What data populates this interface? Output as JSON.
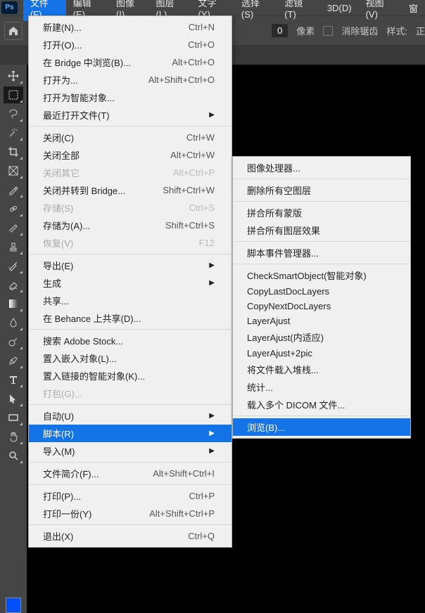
{
  "menubar": {
    "items": [
      "文件(F)",
      "编辑(E)",
      "图像(I)",
      "图层(L)",
      "文字(Y)",
      "选择(S)",
      "滤镜(T)",
      "3D(D)",
      "视图(V)",
      "窗"
    ]
  },
  "optbar": {
    "value": "0",
    "unit": "像素",
    "antialias": "消除锯齿",
    "style": "样式:",
    "normal": "正"
  },
  "fileMenu": [
    {
      "label": "新建(N)...",
      "shortcut": "Ctrl+N"
    },
    {
      "label": "打开(O)...",
      "shortcut": "Ctrl+O"
    },
    {
      "label": "在 Bridge 中浏览(B)...",
      "shortcut": "Alt+Ctrl+O"
    },
    {
      "label": "打开为...",
      "shortcut": "Alt+Shift+Ctrl+O"
    },
    {
      "label": "打开为智能对象..."
    },
    {
      "label": "最近打开文件(T)",
      "arrow": true
    },
    {
      "sep": true
    },
    {
      "label": "关闭(C)",
      "shortcut": "Ctrl+W"
    },
    {
      "label": "关闭全部",
      "shortcut": "Alt+Ctrl+W"
    },
    {
      "label": "关闭其它",
      "shortcut": "Alt+Ctrl+P",
      "disabled": true
    },
    {
      "label": "关闭并转到 Bridge...",
      "shortcut": "Shift+Ctrl+W"
    },
    {
      "label": "存储(S)",
      "shortcut": "Ctrl+S",
      "disabled": true
    },
    {
      "label": "存储为(A)...",
      "shortcut": "Shift+Ctrl+S"
    },
    {
      "label": "恢复(V)",
      "shortcut": "F12",
      "disabled": true
    },
    {
      "sep": true
    },
    {
      "label": "导出(E)",
      "arrow": true
    },
    {
      "label": "生成",
      "arrow": true
    },
    {
      "label": "共享..."
    },
    {
      "label": "在 Behance 上共享(D)..."
    },
    {
      "sep": true
    },
    {
      "label": "搜索 Adobe Stock..."
    },
    {
      "label": "置入嵌入对象(L)..."
    },
    {
      "label": "置入链接的智能对象(K)..."
    },
    {
      "label": "打包(G)...",
      "disabled": true
    },
    {
      "sep": true
    },
    {
      "label": "自动(U)",
      "arrow": true
    },
    {
      "label": "脚本(R)",
      "arrow": true,
      "highlight": true
    },
    {
      "label": "导入(M)",
      "arrow": true
    },
    {
      "sep": true
    },
    {
      "label": "文件简介(F)...",
      "shortcut": "Alt+Shift+Ctrl+I"
    },
    {
      "sep": true
    },
    {
      "label": "打印(P)...",
      "shortcut": "Ctrl+P"
    },
    {
      "label": "打印一份(Y)",
      "shortcut": "Alt+Shift+Ctrl+P"
    },
    {
      "sep": true
    },
    {
      "label": "退出(X)",
      "shortcut": "Ctrl+Q"
    }
  ],
  "scriptsMenu": [
    {
      "label": "图像处理器..."
    },
    {
      "sep": true
    },
    {
      "label": "删除所有空图层"
    },
    {
      "sep": true
    },
    {
      "label": "拼合所有蒙版"
    },
    {
      "label": "拼合所有图层效果"
    },
    {
      "sep": true
    },
    {
      "label": "脚本事件管理器..."
    },
    {
      "sep": true
    },
    {
      "label": "CheckSmartObject(智能对象)"
    },
    {
      "label": "CopyLastDocLayers"
    },
    {
      "label": "CopyNextDocLayers"
    },
    {
      "label": "LayerAjust"
    },
    {
      "label": "LayerAjust(内适应)"
    },
    {
      "label": "LayerAjust+2pic"
    },
    {
      "label": "将文件载入堆栈..."
    },
    {
      "label": "统计..."
    },
    {
      "label": "载入多个 DICOM 文件..."
    },
    {
      "sep": true
    },
    {
      "label": "浏览(B)...",
      "highlight": true
    }
  ],
  "tools": [
    "move",
    "marquee",
    "lasso",
    "wand",
    "crop",
    "frame",
    "eyedrop",
    "heal",
    "brush",
    "stamp",
    "history",
    "eraser",
    "gradient",
    "blur",
    "dodge",
    "pen",
    "type",
    "path",
    "rect",
    "hand",
    "zoom"
  ]
}
